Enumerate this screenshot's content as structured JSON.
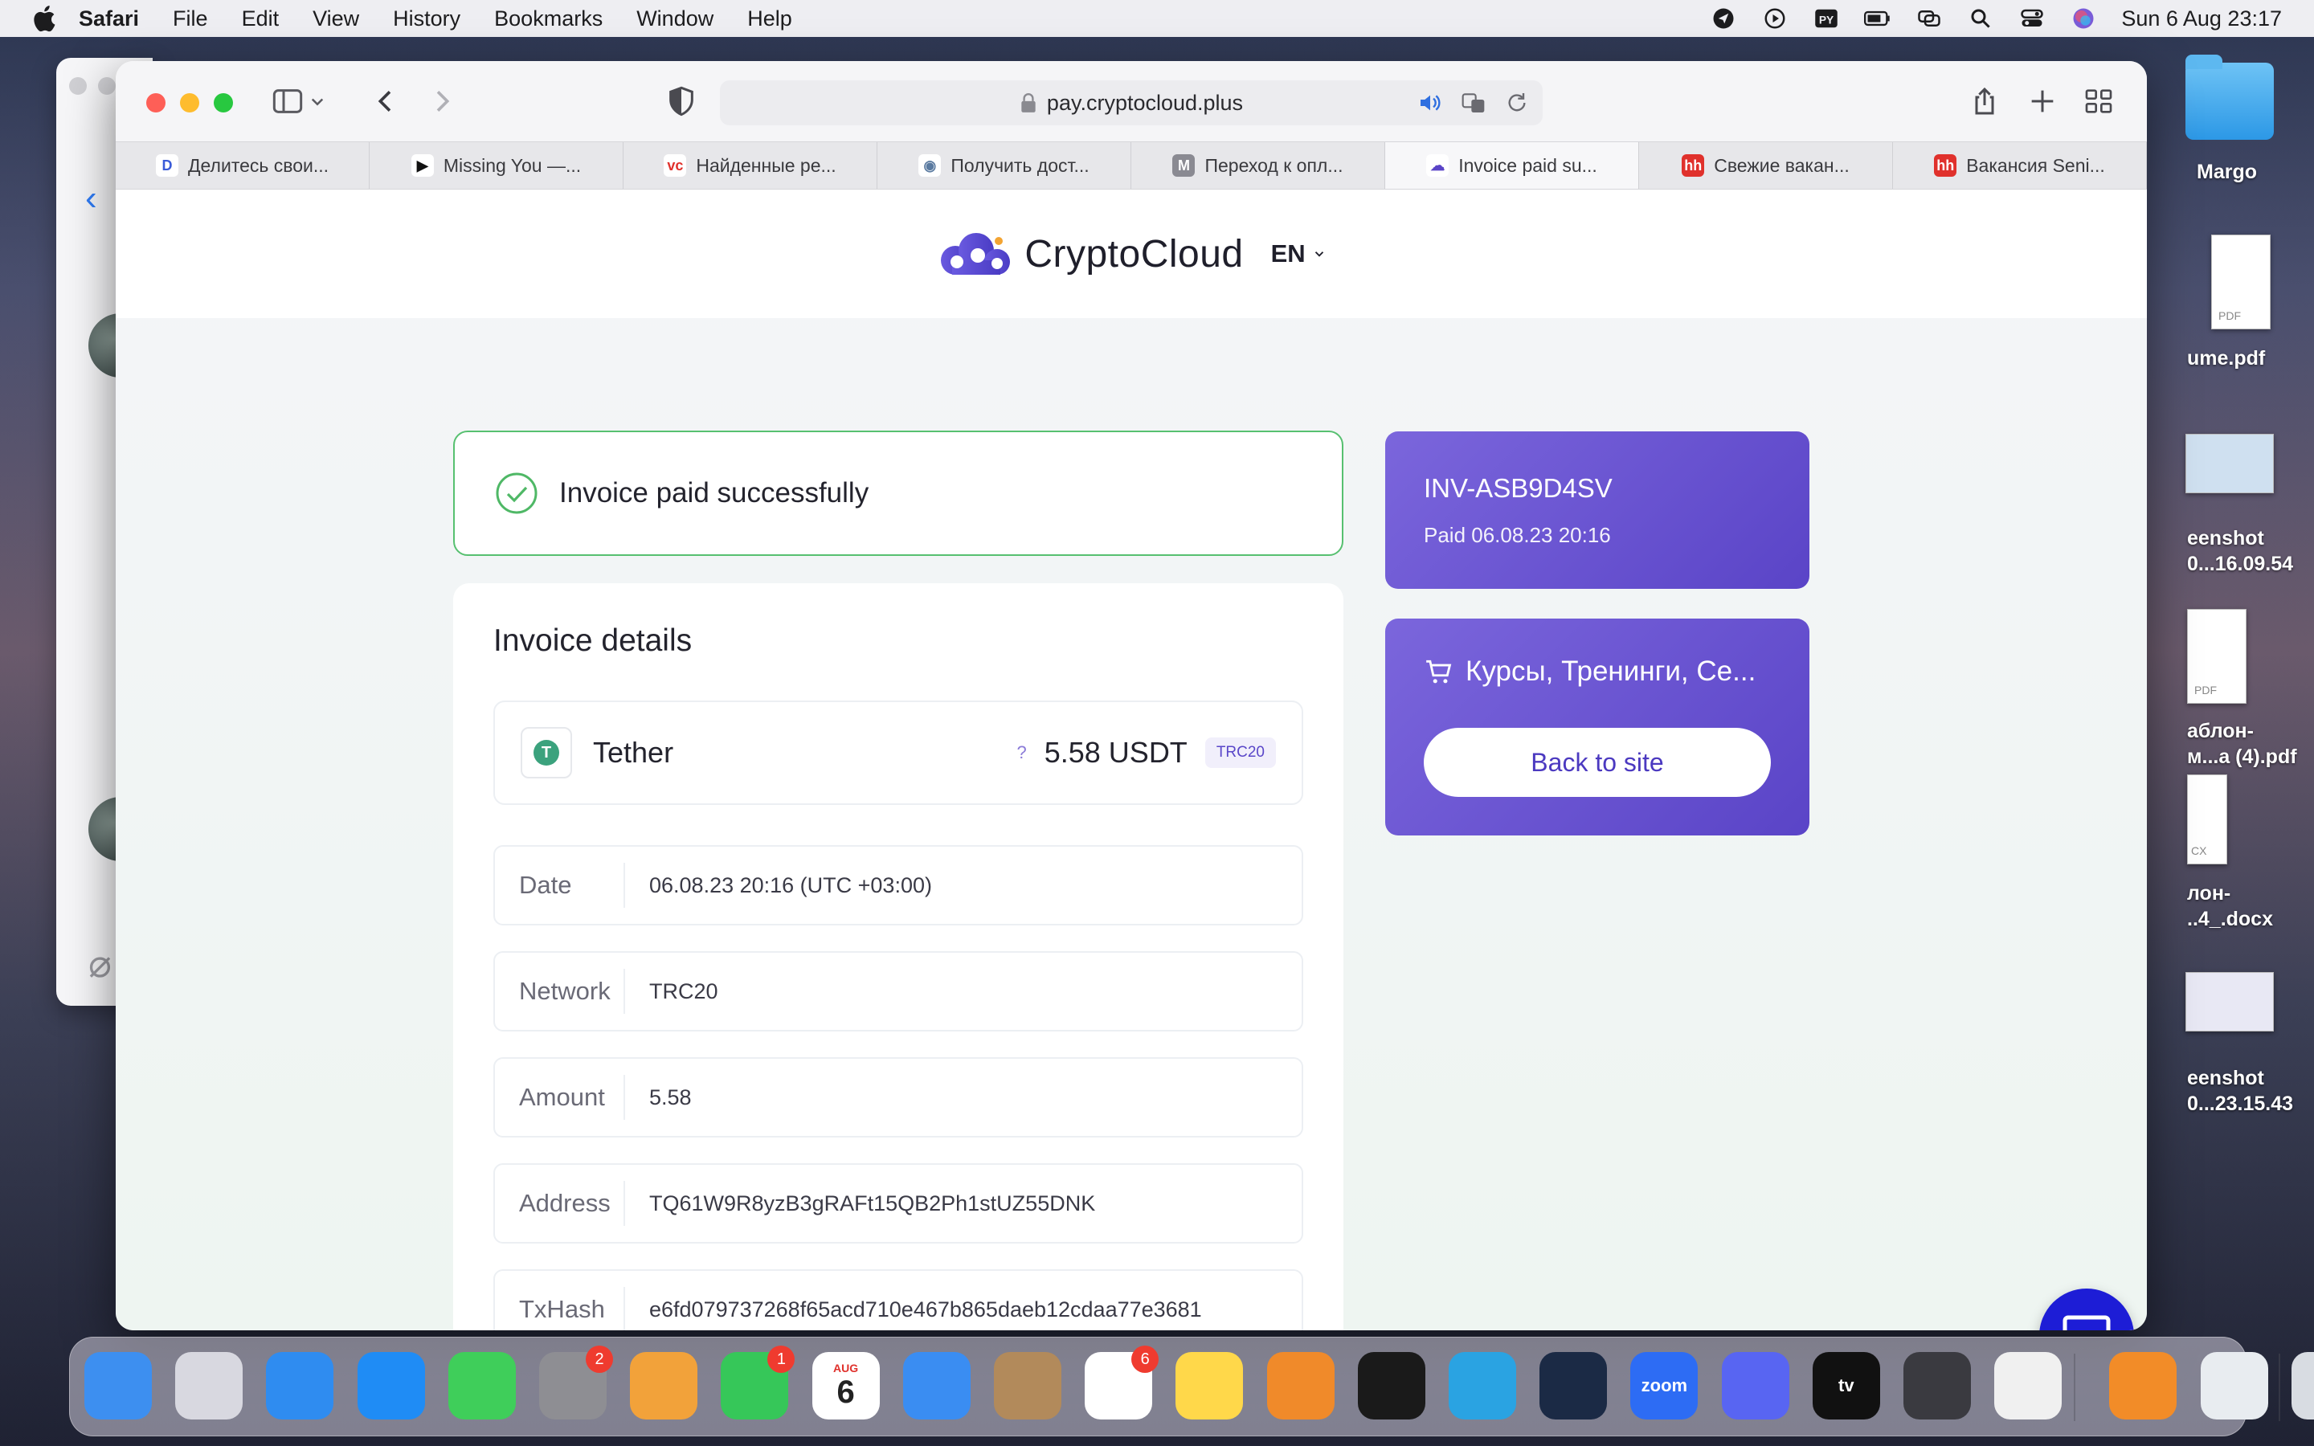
{
  "menubar": {
    "app": "Safari",
    "items": [
      "File",
      "Edit",
      "View",
      "History",
      "Bookmarks",
      "Window",
      "Help"
    ],
    "datetime": "Sun 6 Aug  23:17",
    "status_icons": [
      "location-icon",
      "play-icon",
      "keyboard-layout-icon",
      "battery-icon",
      "screen-mirror-icon",
      "search-icon",
      "control-center-icon",
      "siri-icon"
    ],
    "keyboard_layout": "PY"
  },
  "browser": {
    "url": "pay.cryptocloud.plus",
    "tabs": [
      {
        "label": "Делитесь свои...",
        "fav": "D",
        "fav_color": "#ffffff",
        "fav_text": "#3a5bd8"
      },
      {
        "label": "Missing You —...",
        "fav": "▶",
        "fav_color": "#ffffff",
        "fav_text": "#111111"
      },
      {
        "label": "Найденные ре...",
        "fav": "vc",
        "fav_color": "#ffffff",
        "fav_text": "#e0312c"
      },
      {
        "label": "Получить дост...",
        "fav": "◉",
        "fav_color": "#ffffff",
        "fav_text": "#5a7aa0"
      },
      {
        "label": "Переход к опл...",
        "fav": "M",
        "fav_color": "#8a8a92",
        "fav_text": "#ffffff"
      },
      {
        "label": "Invoice paid su...",
        "fav": "☁",
        "fav_color": "#ffffff",
        "fav_text": "#5a44c7"
      },
      {
        "label": "Свежие вакан...",
        "fav": "hh",
        "fav_color": "#e0312c",
        "fav_text": "#ffffff"
      },
      {
        "label": "Вакансия Seni...",
        "fav": "hh",
        "fav_color": "#e0312c",
        "fav_text": "#ffffff"
      }
    ],
    "active_tab": 5
  },
  "page": {
    "logo": "CryptoCloud",
    "language": "EN",
    "success_message": "Invoice paid successfully",
    "details_title": "Invoice details",
    "coin": {
      "name": "Tether",
      "icon_letter": "T",
      "help": "?",
      "amount": "5.58 USDT",
      "network_badge": "TRC20"
    },
    "rows": [
      {
        "label": "Date",
        "value": "06.08.23 20:16 (UTC +03:00)"
      },
      {
        "label": "Network",
        "value": "TRC20"
      },
      {
        "label": "Amount",
        "value": "5.58"
      },
      {
        "label": "Address",
        "value": "TQ61W9R8yzB3gRAFt15QB2Ph1stUZ55DNK"
      },
      {
        "label": "TxHash",
        "value": "e6fd079737268f65acd710e467b865daeb12cdaa77e3681"
      }
    ],
    "invoice_id": "INV-ASB9D4SV",
    "invoice_paid": "Paid 06.08.23 20:16",
    "shop_name": "Курсы, Тренинги, Се...",
    "back_button": "Back to site"
  },
  "desktop": {
    "items": [
      "Margo",
      "ume.pdf",
      "eenshot",
      "0...16.09.54",
      "аблон-",
      "м...а (4).pdf",
      "лон-",
      "..4_.docx",
      "eenshot",
      "0...23.15.43"
    ],
    "thumb_labels": [
      "PDF",
      "PDF",
      "CX"
    ]
  },
  "dock": {
    "apps": [
      {
        "name": "finder",
        "label": "",
        "color": "#3d8ff0"
      },
      {
        "name": "launchpad",
        "label": "",
        "color": "#d8d8e0"
      },
      {
        "name": "safari",
        "label": "",
        "color": "#2f8cf0"
      },
      {
        "name": "app-store",
        "label": "",
        "color": "#1f8cf5"
      },
      {
        "name": "messages",
        "label": "",
        "color": "#3fce5a"
      },
      {
        "name": "system-settings",
        "label": "",
        "color": "#8e8e93",
        "badge": "2"
      },
      {
        "name": "photos",
        "label": "",
        "color": "#f2a23a"
      },
      {
        "name": "facetime",
        "label": "",
        "color": "#36c759",
        "badge": "1"
      },
      {
        "name": "calendar",
        "label": "6",
        "color": "#ffffff",
        "sub": "AUG"
      },
      {
        "name": "mail",
        "label": "",
        "color": "#3a8df2"
      },
      {
        "name": "contacts",
        "label": "",
        "color": "#b28a5b"
      },
      {
        "name": "reminders",
        "label": "",
        "color": "#ffffff",
        "badge": "6"
      },
      {
        "name": "notes",
        "label": "",
        "color": "#ffd84a"
      },
      {
        "name": "pages",
        "label": "",
        "color": "#f08a2a"
      },
      {
        "name": "binance",
        "label": "",
        "color": "#1a1a1a"
      },
      {
        "name": "telegram",
        "label": "",
        "color": "#2aa3e2"
      },
      {
        "name": "steam",
        "label": "",
        "color": "#1b2a45"
      },
      {
        "name": "zoom",
        "label": "zoom",
        "color": "#2d6cf4"
      },
      {
        "name": "discord",
        "label": "",
        "color": "#5865f2"
      },
      {
        "name": "apple-tv",
        "label": "tv",
        "color": "#111111"
      },
      {
        "name": "quicktime",
        "label": "",
        "color": "#3a3a40"
      },
      {
        "name": "openvpn",
        "label": "",
        "color": "#f0f0f0"
      },
      {
        "name": "books",
        "label": "",
        "color": "#f28c28"
      },
      {
        "name": "preview",
        "label": "",
        "color": "#e8ecf0"
      },
      {
        "name": "trash",
        "label": "",
        "color": "#d8dce2"
      }
    ]
  }
}
